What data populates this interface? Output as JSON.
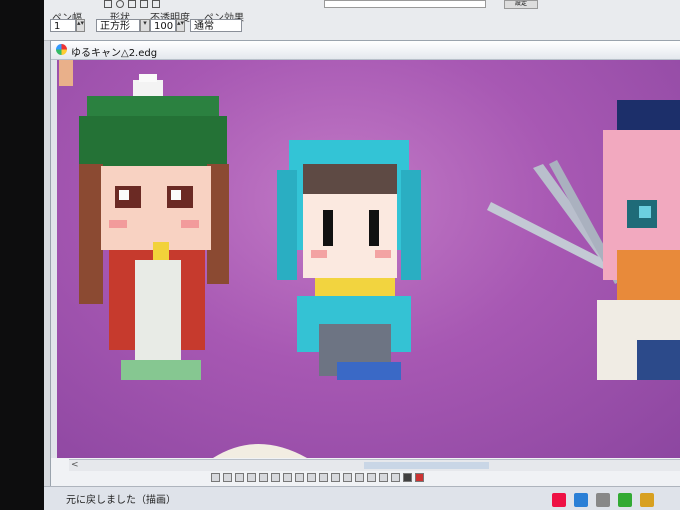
{
  "toolbar": {
    "pen_width_label": "ペン幅",
    "pen_width_value": "1",
    "shape_label": "形状",
    "shape_value": "正方形",
    "opacity_label": "不透明度",
    "opacity_value": "100",
    "effect_label": "ペン効果",
    "effect_value": "通常",
    "right_button": "設定"
  },
  "document": {
    "title": "ゆるキャン△2.edg"
  },
  "status": {
    "text": "元に戻しました（描画）"
  },
  "colors": {
    "canvas_bg": "#a758b3",
    "toolbar_bg": "#e9ebee",
    "titlebar_bg": "#e4e8ee"
  },
  "icons": [
    "app-logo-icon",
    "window-close-icon",
    "scroll-left-arrow-icon"
  ]
}
